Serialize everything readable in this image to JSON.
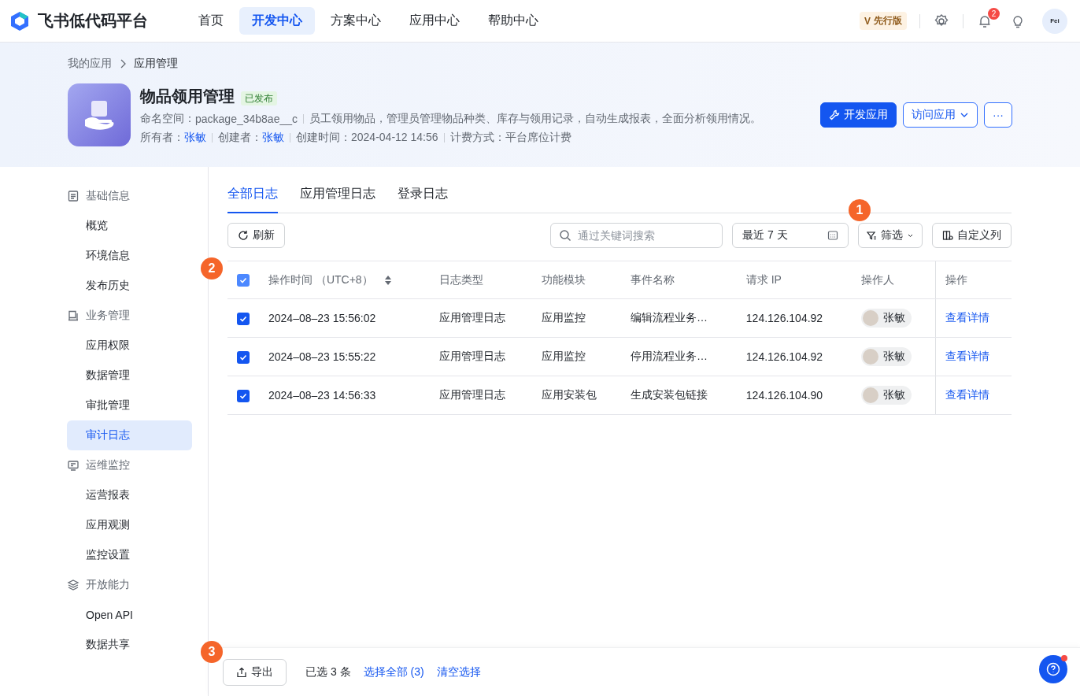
{
  "topbar": {
    "brand": "飞书低代码平台",
    "nav": [
      {
        "label": "首页",
        "selected": false
      },
      {
        "label": "开发中心",
        "selected": true
      },
      {
        "label": "方案中心",
        "selected": false
      },
      {
        "label": "应用中心",
        "selected": false
      },
      {
        "label": "帮助中心",
        "selected": false
      }
    ],
    "edition_mark": "V",
    "edition": "先行版",
    "notification_count": "2",
    "avatar_text": "Fei"
  },
  "breadcrumb": [
    "我的应用",
    "应用管理"
  ],
  "app": {
    "name": "物品领用管理",
    "status": "已发布",
    "namespace_label": "命名空间：",
    "namespace": "package_34b8ae__c",
    "description": "员工领用物品，管理员管理物品种类、库存与领用记录，自动生成报表，全面分析领用情况。",
    "owner_label": "所有者：",
    "owner": "张敏",
    "creator_label": "创建者：",
    "creator": "张敏",
    "created": "创建时间：2024-04-12 14:56",
    "billing": "计费方式：平台席位计费",
    "buttons": [
      {
        "label": "开发应用",
        "kind": "primary"
      },
      {
        "label": "访问应用",
        "kind": "outline"
      },
      {
        "label": "···",
        "kind": "more"
      }
    ]
  },
  "sidebar": [
    {
      "label": "基础信息",
      "children": [
        {
          "label": "概览",
          "selected": false
        },
        {
          "label": "环境信息",
          "selected": false
        },
        {
          "label": "发布历史",
          "selected": false
        }
      ]
    },
    {
      "label": "业务管理",
      "children": [
        {
          "label": "应用权限",
          "selected": false
        },
        {
          "label": "数据管理",
          "selected": false
        },
        {
          "label": "审批管理",
          "selected": false
        },
        {
          "label": "审计日志",
          "selected": true
        }
      ]
    },
    {
      "label": "运维监控",
      "children": [
        {
          "label": "运营报表",
          "selected": false
        },
        {
          "label": "应用观测",
          "selected": false
        },
        {
          "label": "监控设置",
          "selected": false
        }
      ]
    },
    {
      "label": "开放能力",
      "children": [
        {
          "label": "Open API",
          "selected": false
        },
        {
          "label": "数据共享",
          "selected": false
        }
      ]
    }
  ],
  "tabs": [
    {
      "label": "全部日志",
      "selected": true
    },
    {
      "label": "应用管理日志",
      "selected": false
    },
    {
      "label": "登录日志",
      "selected": false
    }
  ],
  "toolbar": {
    "refresh": "刷新",
    "search_placeholder": "通过关键词搜索",
    "date_range": "最近 7 天",
    "filter": "筛选",
    "columns": "自定义列"
  },
  "table": {
    "all_checked": true,
    "columns": [
      "操作时间 （UTC+8）",
      "日志类型",
      "功能模块",
      "事件名称",
      "请求 IP",
      "操作人",
      "操作"
    ],
    "rows": [
      {
        "checked": true,
        "cells": [
          "2024–08–23 15:56:02",
          "应用管理日志",
          "应用监控",
          "编辑流程业务…",
          "124.126.104.92"
        ],
        "operator": "张敏",
        "action": "查看详情"
      },
      {
        "checked": true,
        "cells": [
          "2024–08–23 15:55:22",
          "应用管理日志",
          "应用监控",
          "停用流程业务…",
          "124.126.104.92"
        ],
        "operator": "张敏",
        "action": "查看详情"
      },
      {
        "checked": true,
        "cells": [
          "2024–08–23 14:56:33",
          "应用管理日志",
          "应用安装包",
          "生成安装包链接",
          "124.126.104.90"
        ],
        "operator": "张敏",
        "action": "查看详情"
      }
    ]
  },
  "footer": {
    "export": "导出",
    "selected_count": "已选 3 条",
    "select_all": "选择全部 (3)",
    "clear": "清空选择"
  },
  "callouts": [
    "1",
    "2",
    "3"
  ]
}
